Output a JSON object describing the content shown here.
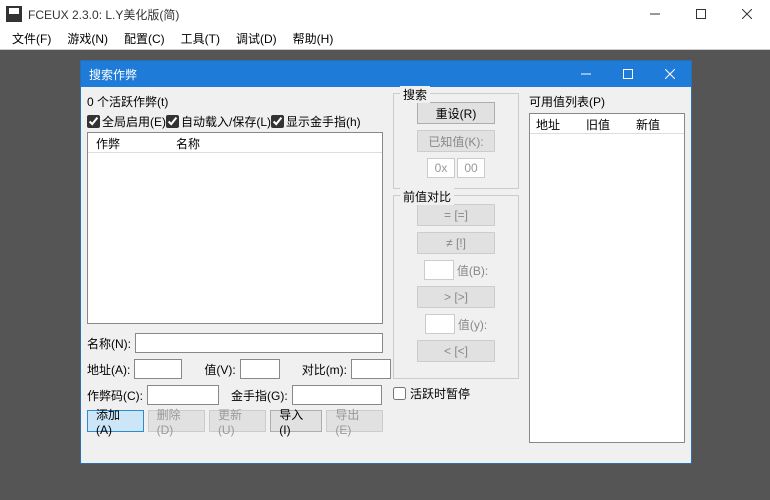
{
  "mainWindow": {
    "title": "FCEUX 2.3.0: L.Y美化版(简)"
  },
  "menubar": [
    "文件(F)",
    "游戏(N)",
    "配置(C)",
    "工具(T)",
    "调试(D)",
    "帮助(H)"
  ],
  "dialog": {
    "title": "搜索作弊",
    "activeCount": "0 个活跃作弊(t)",
    "checks": {
      "global": "全局启用(E)",
      "autoload": "自动载入/保存(L)",
      "showgf": "显示金手指(h)"
    },
    "listHeaders": {
      "cheat": "作弊",
      "name": "名称"
    },
    "labels": {
      "name": "名称(N):",
      "addr": "地址(A):",
      "value": "值(V):",
      "cmp": "对比(m):",
      "code": "作弊码(C):",
      "gf": "金手指(G):"
    },
    "buttons": {
      "add": "添加(A)",
      "delete": "删除(D)",
      "update": "更新(U)",
      "import": "导入(I)",
      "export": "导出(E)"
    },
    "search": {
      "legend": "搜索",
      "reset": "重设(R)",
      "known": "已知值(K):",
      "hexPrefix": "0x",
      "hexVal": "00"
    },
    "compare": {
      "legend": "前值对比",
      "eq": "= [=]",
      "ne": "≠ [!]",
      "byB": "值(B):",
      "gt": "> [>]",
      "byY": "值(y):",
      "lt": "< [<]"
    },
    "pause": "活跃时暂停",
    "rightList": {
      "title": "可用值列表(P)",
      "cols": {
        "addr": "地址",
        "old": "旧值",
        "new": "新值"
      }
    }
  }
}
